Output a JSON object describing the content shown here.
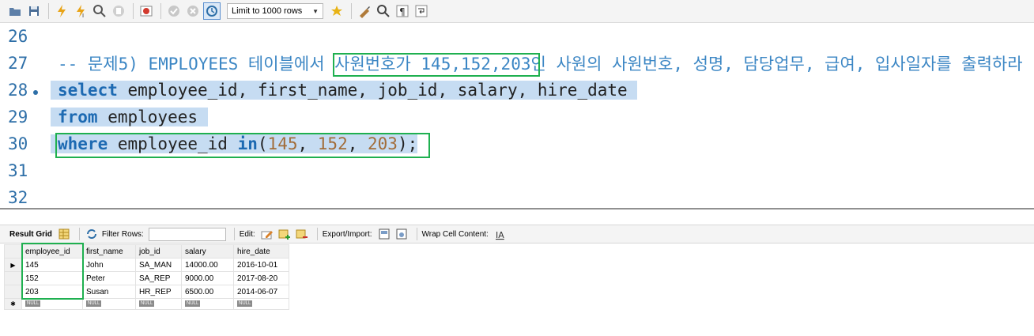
{
  "toolbar": {
    "limit_select": "Limit to 1000 rows",
    "icons": [
      "folder-open-icon",
      "save-icon",
      "execute-icon",
      "execute-current-icon",
      "explain-icon",
      "stop-icon",
      "toggle-continue-icon",
      "commit-icon",
      "rollback-icon",
      "autocommit-icon",
      "beautify-icon",
      "find-icon",
      "invisible-chars-icon",
      "word-wrap-icon"
    ]
  },
  "editor": {
    "lines": [
      {
        "num": "26",
        "tokens": []
      },
      {
        "num": "27",
        "tokens": [
          {
            "t": "-- 문제5) EMPLOYEES 테이블에서 ",
            "c": "cmt"
          },
          {
            "t": "사원번호가 145,152,203",
            "c": "cmt"
          },
          {
            "t": "인 사원의 사원번호, 성명, 담당업무, 급여, 입사일자를 출력하라",
            "c": "cmt"
          }
        ]
      },
      {
        "num": "28",
        "tokens": [
          {
            "t": "select",
            "c": "kw"
          },
          {
            "t": " employee_id, first_name, job_id, salary, hire_date ",
            "c": "txt"
          }
        ]
      },
      {
        "num": "29",
        "tokens": [
          {
            "t": "from",
            "c": "kw"
          },
          {
            "t": " employees ",
            "c": "txt"
          }
        ]
      },
      {
        "num": "30",
        "tokens": [
          {
            "t": "where",
            "c": "kw"
          },
          {
            "t": " employee_id ",
            "c": "txt"
          },
          {
            "t": "in",
            "c": "kw"
          },
          {
            "t": "(",
            "c": "txt"
          },
          {
            "t": "145",
            "c": "num"
          },
          {
            "t": ", ",
            "c": "txt"
          },
          {
            "t": "152",
            "c": "num"
          },
          {
            "t": ", ",
            "c": "txt"
          },
          {
            "t": "203",
            "c": "num"
          },
          {
            "t": ");",
            "c": "txt"
          }
        ]
      },
      {
        "num": "31",
        "tokens": []
      },
      {
        "num": "32",
        "tokens": []
      }
    ]
  },
  "result_toolbar": {
    "result_grid": "Result Grid",
    "filter_rows": "Filter Rows:",
    "edit": "Edit:",
    "export_import": "Export/Import:",
    "wrap_cell": "Wrap Cell Content:"
  },
  "grid": {
    "columns": [
      "employee_id",
      "first_name",
      "job_id",
      "salary",
      "hire_date"
    ],
    "rows": [
      [
        "145",
        "John",
        "SA_MAN",
        "14000.00",
        "2016-10-01"
      ],
      [
        "152",
        "Peter",
        "SA_REP",
        "9000.00",
        "2017-08-20"
      ],
      [
        "203",
        "Susan",
        "HR_REP",
        "6500.00",
        "2014-06-07"
      ]
    ],
    "null_label": "NULL"
  },
  "colors": {
    "keyword": "#1d6ab2",
    "comment": "#3b86c4",
    "number": "#a26d3a",
    "selection": "#c6dcf2",
    "highlight_box": "#1fb050"
  }
}
